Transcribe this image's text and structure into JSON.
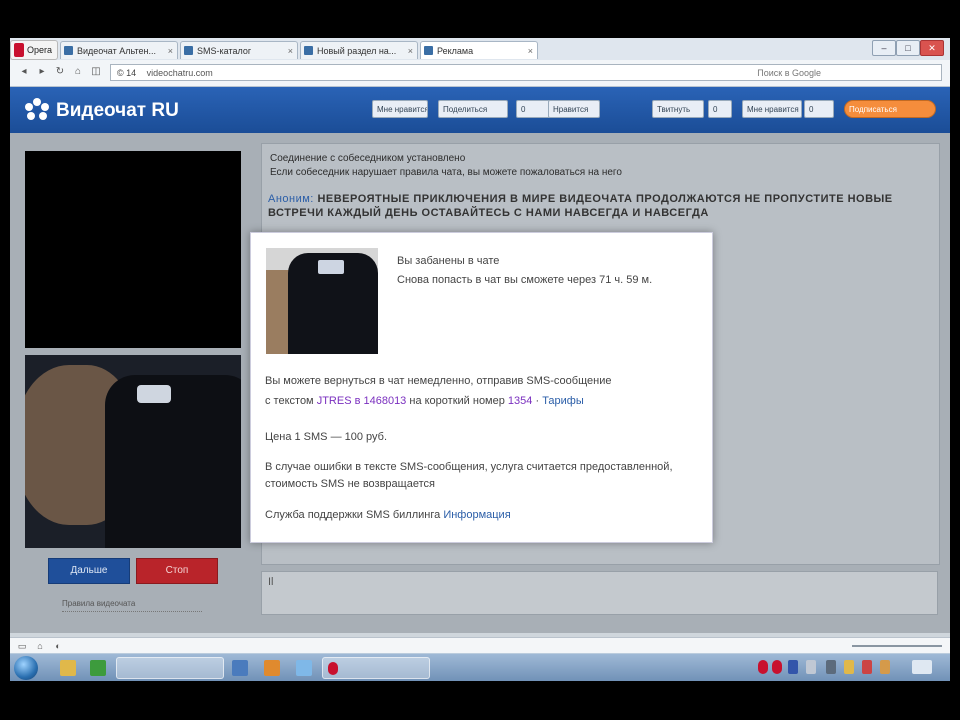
{
  "browser": {
    "menu_label": "Opera",
    "tabs": [
      {
        "label": "Видеочат Альтен..."
      },
      {
        "label": "SMS-каталог"
      },
      {
        "label": "Новый раздел на..."
      },
      {
        "label": "Реклама"
      }
    ],
    "window_controls": {
      "minimize": "–",
      "maximize": "□",
      "close": "✕"
    },
    "address": {
      "security": "© 14",
      "url": "videochatru.com",
      "right_text": "Поиск в Google"
    }
  },
  "site": {
    "title": "Видеочат RU",
    "social_buttons": [
      "Мне нравится",
      "Поделиться",
      "Нравится",
      "Твитнуть",
      "Мне нравится",
      "Подписаться"
    ]
  },
  "video": {
    "next_label": "Дальше",
    "stop_label": "Стоп",
    "under_link": "Правила видеочата"
  },
  "chat": {
    "intro_line1": "Соединение с собеседником установлено",
    "intro_line2": "Если собеседник нарушает правила чата, вы можете пожаловаться на него",
    "message_author": "Аноним:",
    "message_text": "НЕВЕРОЯТНЫЕ ПРИКЛЮЧЕНИЯ В МИРЕ ВИДЕОЧАТА ПРОДОЛЖАЮТСЯ НЕ ПРОПУСТИТЕ НОВЫЕ ВСТРЕЧИ КАЖДЫЙ ДЕНЬ ОСТАВАЙТЕСЬ С НАМИ НАВСЕГДА И НАВСЕГДА",
    "input_value": "Il"
  },
  "modal": {
    "title": "Вы забанены в чате",
    "subtitle": "Снова попасть в чат вы сможете через 71 ч. 59 м.",
    "p1_line1": "Вы можете вернуться в чат немедленно, отправив SMS-сообщение",
    "p1_line2_a": "с текстом",
    "p1_code": "JTRES в 1468013",
    "p1_line2_b": "на короткий номер",
    "p1_number": "1354",
    "p1_tariff": "Тарифы",
    "price": "Цена 1 SMS — 100 руб.",
    "p3_line1": "В случае ошибки в тексте SMS-сообщения, услуга считается предоставленной,",
    "p3_line2": "стоимость SMS не возвращается",
    "support_label": "Служба поддержки SMS биллинга",
    "support_link": "Информация"
  },
  "colors": {
    "header_blue": "#1f55a4",
    "next_button": "#1f4f9a",
    "stop_button": "#b9242a",
    "link_purple": "#7a2fbf",
    "link_blue": "#2b5ea8"
  }
}
